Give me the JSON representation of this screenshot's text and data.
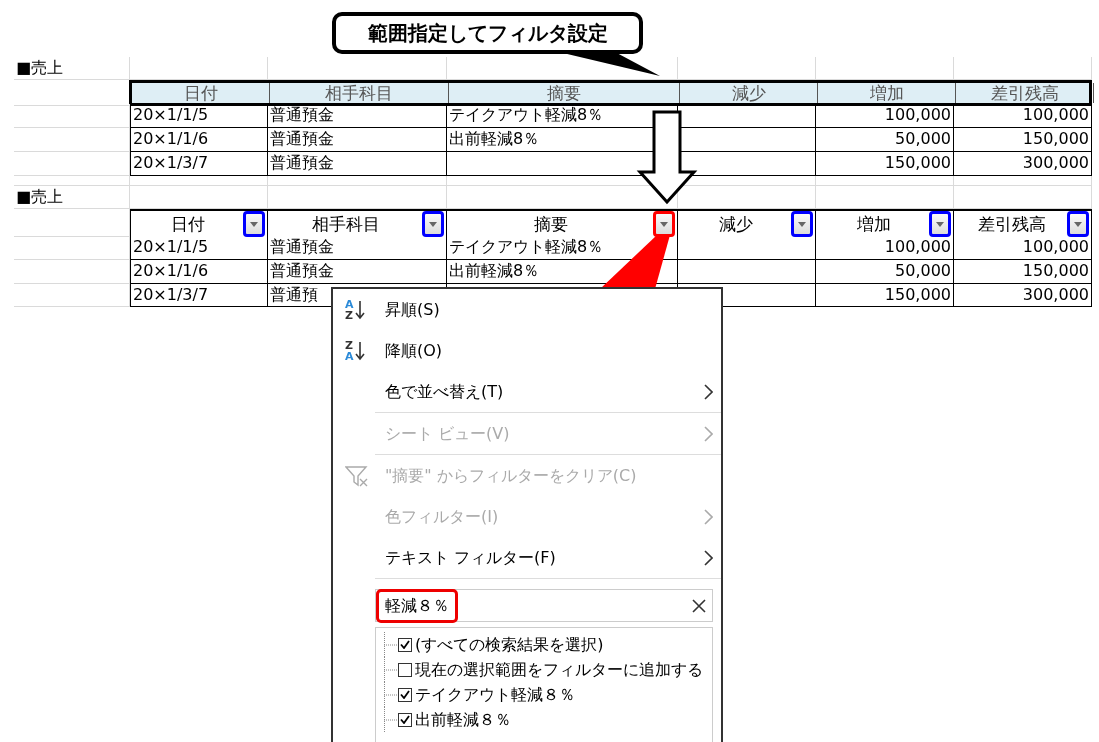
{
  "callout": {
    "text": "範囲指定してフィルタ設定"
  },
  "sheet_before": {
    "title": "■売上",
    "header_selected": true,
    "columns": [
      {
        "label": "日付",
        "kind": "text"
      },
      {
        "label": "相手科目",
        "kind": "text"
      },
      {
        "label": "摘要",
        "kind": "text"
      },
      {
        "label": "減少",
        "kind": "number"
      },
      {
        "label": "増加",
        "kind": "number"
      },
      {
        "label": "差引残高",
        "kind": "number"
      }
    ],
    "rows": [
      [
        "20×1/1/5",
        "普通預金",
        "テイクアウト軽減8％",
        null,
        "100,000",
        "100,000"
      ],
      [
        "20×1/1/6",
        "普通預金",
        "出前軽減8％",
        null,
        "50,000",
        "150,000"
      ],
      [
        "20×1/3/7",
        "普通預金",
        null,
        null,
        "150,000",
        "300,000"
      ]
    ]
  },
  "sheet_after": {
    "title": "■売上",
    "header_selected": false,
    "columns": [
      {
        "label": "日付",
        "kind": "text",
        "color": "#0000ff"
      },
      {
        "label": "相手科目",
        "kind": "text",
        "color": "#0000ff"
      },
      {
        "label": "摘要",
        "kind": "text",
        "color": "#ff0000"
      },
      {
        "label": "減少",
        "kind": "number",
        "color": "#0000ff"
      },
      {
        "label": "増加",
        "kind": "number",
        "color": "#0000ff"
      },
      {
        "label": "差引残高",
        "kind": "number",
        "color": "#0000ff"
      }
    ],
    "rows": [
      [
        "20×1/1/5",
        "普通預金",
        "テイクアウト軽減8％",
        null,
        "100,000",
        "100,000"
      ],
      [
        "20×1/1/6",
        "普通預金",
        "出前軽減8％",
        null,
        "50,000",
        "150,000"
      ],
      [
        "20×1/3/7",
        "普通預",
        null,
        null,
        "150,000",
        "300,000"
      ]
    ]
  },
  "filter_menu": {
    "items": [
      {
        "kind": "sort-ascending",
        "label": "昇順(S)",
        "icon_letters": [
          "A",
          "Z"
        ],
        "disabled": false,
        "submenu": false
      },
      {
        "kind": "sort-descending",
        "label": "降順(O)",
        "icon_letters": [
          "Z",
          "A"
        ],
        "disabled": false,
        "submenu": false
      },
      {
        "kind": "plain",
        "label": "色で並べ替え(T)",
        "disabled": false,
        "submenu": true
      },
      {
        "kind": "divider"
      },
      {
        "kind": "plain",
        "label": "シート ビュー(V)",
        "disabled": true,
        "submenu": true
      },
      {
        "kind": "divider"
      },
      {
        "kind": "clear-filter",
        "label": "\"摘要\" からフィルターをクリア(C)",
        "disabled": true,
        "submenu": false
      },
      {
        "kind": "plain",
        "label": "色フィルター(I)",
        "disabled": true,
        "submenu": true
      },
      {
        "kind": "plain",
        "label": "テキスト フィルター(F)",
        "disabled": false,
        "submenu": true
      },
      {
        "kind": "divider"
      }
    ],
    "search": {
      "value": "軽減８％",
      "highlighted": true
    },
    "options": [
      {
        "label": "(すべての検索結果を選択)",
        "checked": true
      },
      {
        "label": "現在の選択範囲をフィルターに追加する",
        "checked": false
      },
      {
        "label": "テイクアウト軽減８％",
        "checked": true
      },
      {
        "label": "出前軽減８％",
        "checked": true
      }
    ]
  }
}
